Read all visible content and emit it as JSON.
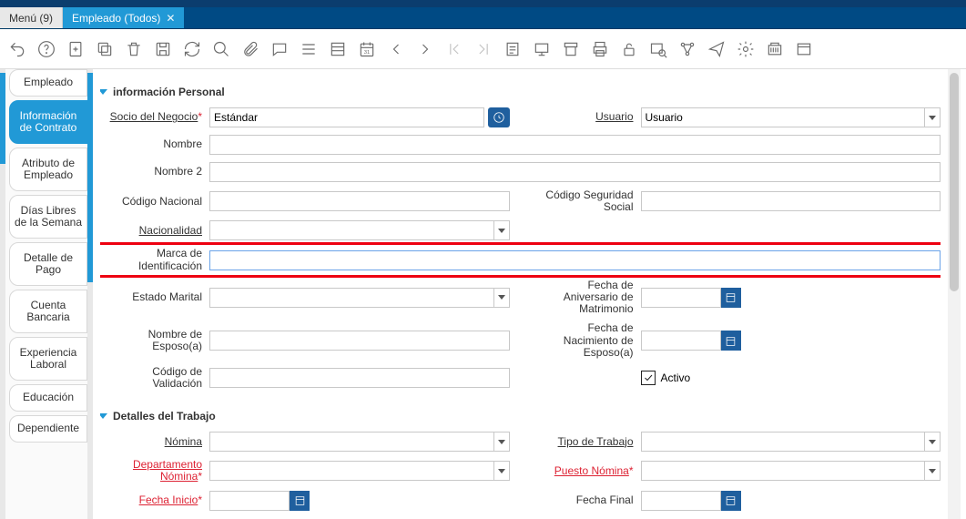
{
  "tabs": {
    "menu": "Menú (9)",
    "emp": "Empleado (Todos)"
  },
  "side": {
    "items": [
      "Empleado",
      "Información de Contrato",
      "Atributo de Empleado",
      "Días Libres de la Semana",
      "Detalle de Pago",
      "Cuenta Bancaria",
      "Experiencia Laboral",
      "Educación",
      "Dependiente"
    ],
    "activeIndex": 1
  },
  "sections": {
    "personal": "información Personal",
    "trabajo": "Detalles del Trabajo"
  },
  "labels": {
    "socio": "Socio del Negocio",
    "usuario": "Usuario",
    "nombre": "Nombre",
    "nombre2": "Nombre 2",
    "codigoNacional": "Código Nacional",
    "codigoSS": "Código Seguridad Social",
    "nacionalidad": "Nacionalidad",
    "marcaId": "Marca de Identificación",
    "estadoMarital": "Estado Marital",
    "aniversario": "Fecha de Aniversario de Matrimonio",
    "esposo": "Nombre de Esposo(a)",
    "nacEsposo": "Fecha de Nacimiento de Esposo(a)",
    "codigoVal": "Código de Validación",
    "activo": "Activo",
    "nomina": "Nómina",
    "tipoTrabajo": "Tipo de Trabajo",
    "depNomina": "Departamento Nómina",
    "puestoNomina": "Puesto Nómina",
    "fechaInicio": "Fecha Inicio",
    "fechaFinal": "Fecha Final",
    "asterisk": "*"
  },
  "values": {
    "socio": "Estándar",
    "usuario": "Usuario",
    "nombre": "",
    "nombre2": "",
    "codigoNacional": "",
    "codigoSS": "",
    "nacionalidad": "",
    "marcaId": "",
    "estadoMarital": "",
    "aniversario": "",
    "esposo": "",
    "nacEsposo": "",
    "codigoVal": "",
    "activo": true,
    "nomina": "",
    "tipoTrabajo": "",
    "depNomina": "",
    "puestoNomina": "",
    "fechaInicio": "",
    "fechaFinal": ""
  }
}
